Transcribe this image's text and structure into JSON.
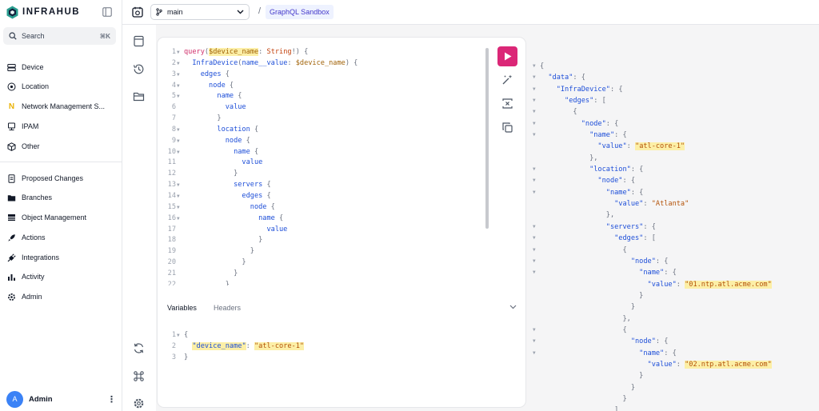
{
  "app": {
    "brand": "INFRAHUB"
  },
  "search": {
    "label": "Search",
    "shortcut": "⌘K"
  },
  "nav_main": [
    {
      "label": "Device",
      "icon": "device-icon"
    },
    {
      "label": "Location",
      "icon": "location-pin-icon"
    },
    {
      "label": "Network Management S...",
      "icon": "letter-n-icon"
    },
    {
      "label": "IPAM",
      "icon": "ipam-icon"
    },
    {
      "label": "Other",
      "icon": "cube-icon"
    }
  ],
  "nav_secondary": [
    {
      "label": "Proposed Changes",
      "icon": "document-icon"
    },
    {
      "label": "Branches",
      "icon": "folder-icon"
    },
    {
      "label": "Object Management",
      "icon": "stack-icon"
    },
    {
      "label": "Actions",
      "icon": "rocket-icon"
    },
    {
      "label": "Integrations",
      "icon": "plug-icon"
    },
    {
      "label": "Activity",
      "icon": "activity-icon"
    },
    {
      "label": "Admin",
      "icon": "gear-icon"
    }
  ],
  "user": {
    "initial": "A",
    "name": "Admin"
  },
  "header": {
    "branch": "main",
    "separator": "/",
    "breadcrumb": "GraphQL Sandbox"
  },
  "editor": {
    "query_lines": [
      {
        "n": "1",
        "fold": true,
        "parts": [
          [
            "kw",
            "query"
          ],
          [
            "pn",
            "("
          ],
          [
            "var hl",
            "$device_name"
          ],
          [
            "pn",
            ": "
          ],
          [
            "typ",
            "String"
          ],
          [
            "pn",
            "!) {"
          ]
        ]
      },
      {
        "n": "2",
        "fold": true,
        "parts": [
          [
            "fld",
            "  InfraDevice"
          ],
          [
            "pn",
            "("
          ],
          [
            "fld",
            "name__value"
          ],
          [
            "pn",
            ": "
          ],
          [
            "var",
            "$device_name"
          ],
          [
            "pn",
            ") {"
          ]
        ]
      },
      {
        "n": "3",
        "fold": true,
        "parts": [
          [
            "fld",
            "    edges"
          ],
          [
            "pn",
            " {"
          ]
        ]
      },
      {
        "n": "4",
        "fold": true,
        "parts": [
          [
            "fld",
            "      node"
          ],
          [
            "pn",
            " {"
          ]
        ]
      },
      {
        "n": "5",
        "fold": true,
        "parts": [
          [
            "fld",
            "        name"
          ],
          [
            "pn",
            " {"
          ]
        ]
      },
      {
        "n": "6",
        "fold": false,
        "parts": [
          [
            "fld",
            "          value"
          ]
        ]
      },
      {
        "n": "7",
        "fold": false,
        "parts": [
          [
            "pn",
            "        }"
          ]
        ]
      },
      {
        "n": "8",
        "fold": true,
        "parts": [
          [
            "fld",
            "        location"
          ],
          [
            "pn",
            " {"
          ]
        ]
      },
      {
        "n": "9",
        "fold": true,
        "parts": [
          [
            "fld",
            "          node"
          ],
          [
            "pn",
            " {"
          ]
        ]
      },
      {
        "n": "10",
        "fold": true,
        "parts": [
          [
            "fld",
            "            name"
          ],
          [
            "pn",
            " {"
          ]
        ]
      },
      {
        "n": "11",
        "fold": false,
        "parts": [
          [
            "fld",
            "              value"
          ]
        ]
      },
      {
        "n": "12",
        "fold": false,
        "parts": [
          [
            "pn",
            "            }"
          ]
        ]
      },
      {
        "n": "13",
        "fold": true,
        "parts": [
          [
            "fld",
            "            servers"
          ],
          [
            "pn",
            " {"
          ]
        ]
      },
      {
        "n": "14",
        "fold": true,
        "parts": [
          [
            "fld",
            "              edges"
          ],
          [
            "pn",
            " {"
          ]
        ]
      },
      {
        "n": "15",
        "fold": true,
        "parts": [
          [
            "fld",
            "                node"
          ],
          [
            "pn",
            " {"
          ]
        ]
      },
      {
        "n": "16",
        "fold": true,
        "parts": [
          [
            "fld",
            "                  name"
          ],
          [
            "pn",
            " {"
          ]
        ]
      },
      {
        "n": "17",
        "fold": false,
        "parts": [
          [
            "fld",
            "                    value"
          ]
        ]
      },
      {
        "n": "18",
        "fold": false,
        "parts": [
          [
            "pn",
            "                  }"
          ]
        ]
      },
      {
        "n": "19",
        "fold": false,
        "parts": [
          [
            "pn",
            "                }"
          ]
        ]
      },
      {
        "n": "20",
        "fold": false,
        "parts": [
          [
            "pn",
            "              }"
          ]
        ]
      },
      {
        "n": "21",
        "fold": false,
        "parts": [
          [
            "pn",
            "            }"
          ]
        ]
      },
      {
        "n": "22",
        "fold": false,
        "parts": [
          [
            "pn",
            "          }"
          ]
        ]
      }
    ],
    "tabs": {
      "variables": "Variables",
      "headers": "Headers"
    },
    "variable_lines": [
      {
        "n": "1",
        "fold": true,
        "parts": [
          [
            "pn",
            "{"
          ]
        ]
      },
      {
        "n": "2",
        "fold": false,
        "parts": [
          [
            "pn",
            "  "
          ],
          [
            "rkey hl",
            "\"device_name\""
          ],
          [
            "pn",
            ": "
          ],
          [
            "str hl",
            "\"atl-core-1\""
          ]
        ]
      },
      {
        "n": "3",
        "fold": false,
        "parts": [
          [
            "pn",
            "}"
          ]
        ]
      }
    ]
  },
  "result_lines": [
    {
      "fold": true,
      "parts": [
        [
          "pn",
          "{"
        ]
      ]
    },
    {
      "fold": true,
      "parts": [
        [
          "rkey",
          "  \"data\""
        ],
        [
          "pn",
          ": {"
        ]
      ]
    },
    {
      "fold": true,
      "parts": [
        [
          "rkey",
          "    \"InfraDevice\""
        ],
        [
          "pn",
          ": {"
        ]
      ]
    },
    {
      "fold": true,
      "parts": [
        [
          "rkey",
          "      \"edges\""
        ],
        [
          "pn",
          ": ["
        ]
      ]
    },
    {
      "fold": true,
      "parts": [
        [
          "pn",
          "        {"
        ]
      ]
    },
    {
      "fold": true,
      "parts": [
        [
          "rkey",
          "          \"node\""
        ],
        [
          "pn",
          ": {"
        ]
      ]
    },
    {
      "fold": true,
      "parts": [
        [
          "rkey",
          "            \"name\""
        ],
        [
          "pn",
          ": {"
        ]
      ]
    },
    {
      "fold": false,
      "parts": [
        [
          "rkey",
          "              \"value\""
        ],
        [
          "pn",
          ": "
        ],
        [
          "rstr",
          "\"atl-core-1\""
        ]
      ]
    },
    {
      "fold": false,
      "parts": [
        [
          "pn",
          "            },"
        ]
      ]
    },
    {
      "fold": true,
      "parts": [
        [
          "rkey",
          "            \"location\""
        ],
        [
          "pn",
          ": {"
        ]
      ]
    },
    {
      "fold": true,
      "parts": [
        [
          "rkey",
          "              \"node\""
        ],
        [
          "pn",
          ": {"
        ]
      ]
    },
    {
      "fold": true,
      "parts": [
        [
          "rkey",
          "                \"name\""
        ],
        [
          "pn",
          ": {"
        ]
      ]
    },
    {
      "fold": false,
      "parts": [
        [
          "rkey",
          "                  \"value\""
        ],
        [
          "pn",
          ": "
        ],
        [
          "str",
          "\"Atlanta\""
        ]
      ]
    },
    {
      "fold": false,
      "parts": [
        [
          "pn",
          "                },"
        ]
      ]
    },
    {
      "fold": true,
      "parts": [
        [
          "rkey",
          "                \"servers\""
        ],
        [
          "pn",
          ": {"
        ]
      ]
    },
    {
      "fold": true,
      "parts": [
        [
          "rkey",
          "                  \"edges\""
        ],
        [
          "pn",
          ": ["
        ]
      ]
    },
    {
      "fold": true,
      "parts": [
        [
          "pn",
          "                    {"
        ]
      ]
    },
    {
      "fold": true,
      "parts": [
        [
          "rkey",
          "                      \"node\""
        ],
        [
          "pn",
          ": {"
        ]
      ]
    },
    {
      "fold": true,
      "parts": [
        [
          "rkey",
          "                        \"name\""
        ],
        [
          "pn",
          ": {"
        ]
      ]
    },
    {
      "fold": false,
      "parts": [
        [
          "rkey",
          "                          \"value\""
        ],
        [
          "pn",
          ": "
        ],
        [
          "rstr",
          "\"01.ntp.atl.acme.com\""
        ]
      ]
    },
    {
      "fold": false,
      "parts": [
        [
          "pn",
          "                        }"
        ]
      ]
    },
    {
      "fold": false,
      "parts": [
        [
          "pn",
          "                      }"
        ]
      ]
    },
    {
      "fold": false,
      "parts": [
        [
          "pn",
          "                    },"
        ]
      ]
    },
    {
      "fold": true,
      "parts": [
        [
          "pn",
          "                    {"
        ]
      ]
    },
    {
      "fold": true,
      "parts": [
        [
          "rkey",
          "                      \"node\""
        ],
        [
          "pn",
          ": {"
        ]
      ]
    },
    {
      "fold": true,
      "parts": [
        [
          "rkey",
          "                        \"name\""
        ],
        [
          "pn",
          ": {"
        ]
      ]
    },
    {
      "fold": false,
      "parts": [
        [
          "rkey",
          "                          \"value\""
        ],
        [
          "pn",
          ": "
        ],
        [
          "rstr",
          "\"02.ntp.atl.acme.com\""
        ]
      ]
    },
    {
      "fold": false,
      "parts": [
        [
          "pn",
          "                        }"
        ]
      ]
    },
    {
      "fold": false,
      "parts": [
        [
          "pn",
          "                      }"
        ]
      ]
    },
    {
      "fold": false,
      "parts": [
        [
          "pn",
          "                    }"
        ]
      ]
    },
    {
      "fold": false,
      "parts": [
        [
          "pn",
          "                  ]"
        ]
      ]
    }
  ],
  "colors": {
    "accent": "#db2777",
    "highlight": "#fcefa7",
    "avatar": "#3b82f6"
  }
}
